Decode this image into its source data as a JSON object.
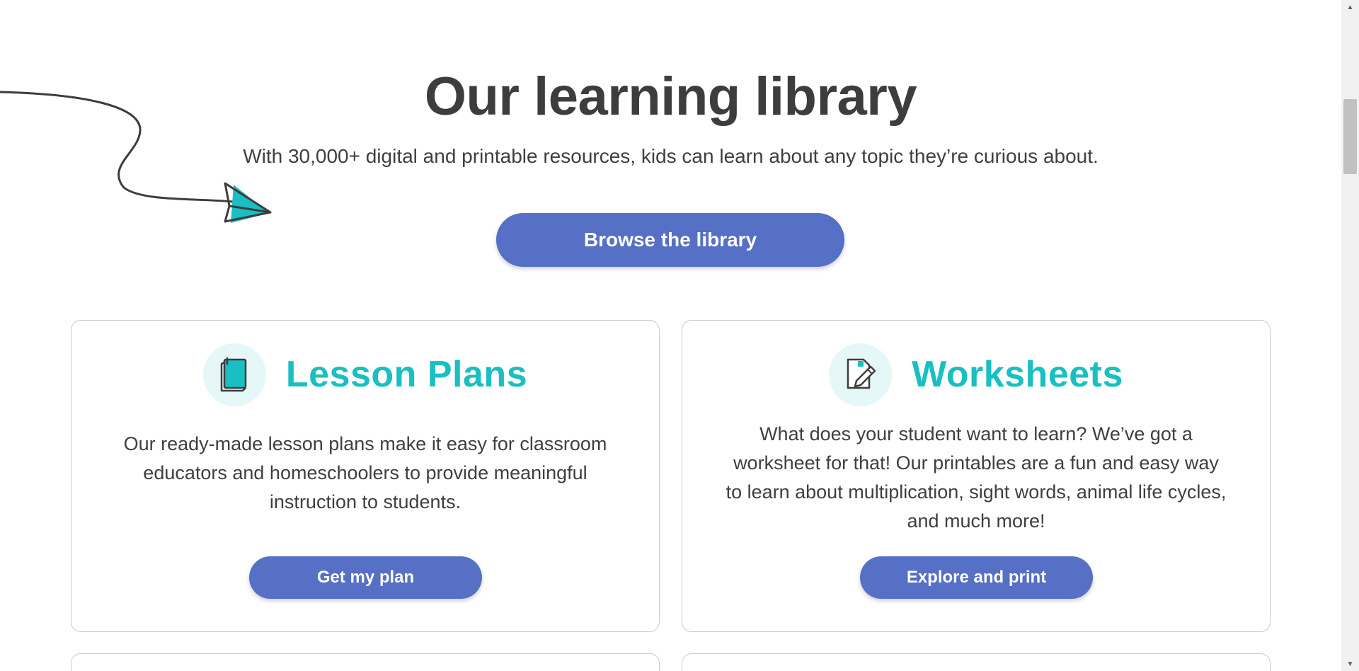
{
  "library": {
    "title": "Our learning library",
    "subtitle": "With 30,000+ digital and printable resources, kids can learn about any topic they’re curious about.",
    "browse_button": "Browse the library"
  },
  "cards": [
    {
      "title": "Lesson Plans",
      "icon": "book-icon",
      "description": "Our ready-made lesson plans make it easy for classroom educators and homeschoolers to provide meaningful instruction to students.",
      "button": "Get my plan"
    },
    {
      "title": "Worksheets",
      "icon": "worksheet-pencil-icon",
      "description": "What does your student want to learn? We’ve got a worksheet for that! Our printables are a fun and easy way to learn about multiplication, sight words, animal life cycles, and much more!",
      "button": "Explore and print"
    }
  ],
  "colors": {
    "button": "#5670c5",
    "card_title": "#19bfc2",
    "icon_bg": "#e5f7f6",
    "text": "#3f3f3f"
  }
}
